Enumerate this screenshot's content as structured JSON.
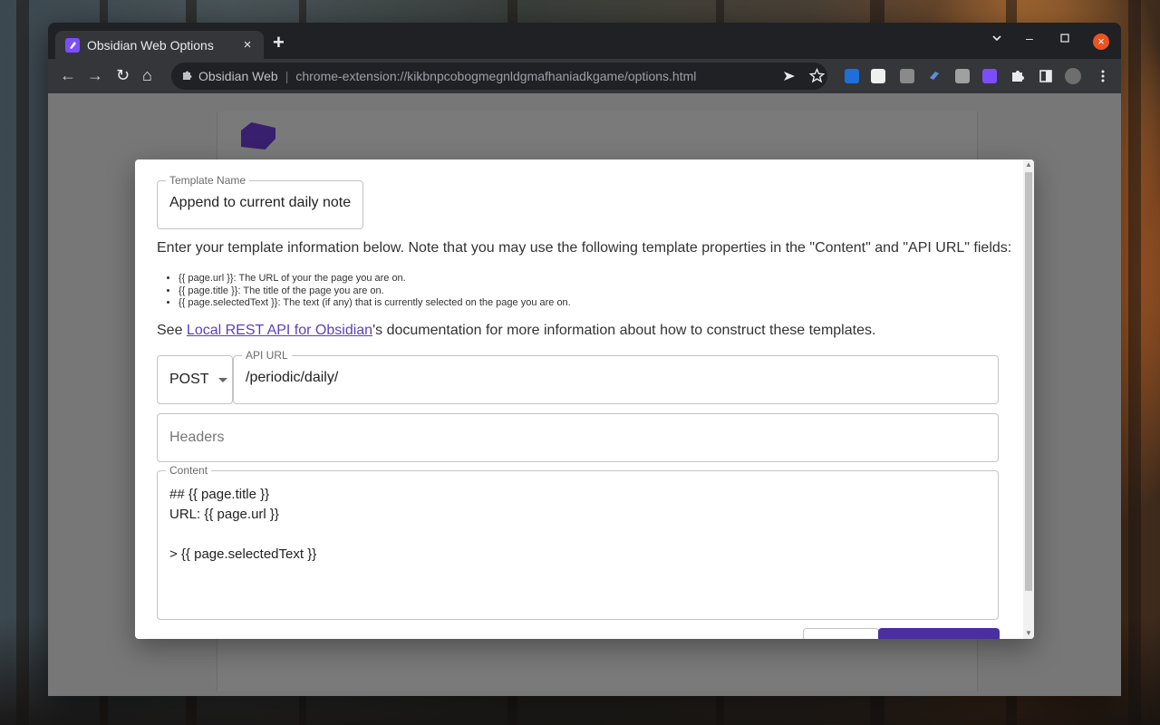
{
  "browser": {
    "tab_title": "Obsidian Web Options",
    "tab_close": "×",
    "new_tab": "+",
    "site_name": "Obsidian Web",
    "url": "chrome-extension://kikbnpcobogmegnldgmafhaniadkgame/options.html",
    "omni_separator": "|",
    "window_controls": {
      "dropdown": "⌄",
      "minimize": "–",
      "maximize": "□",
      "close": "×"
    },
    "nav": {
      "back": "←",
      "forward": "→",
      "reload": "↻",
      "home": "⌂"
    },
    "toolbar_icons": [
      "send-icon",
      "star-icon",
      "extension-1-icon",
      "extension-2-icon",
      "extension-3-icon",
      "extension-4-icon",
      "extension-5-icon",
      "obsidian-extension-icon",
      "puzzle-icon",
      "side-panel-icon",
      "profile-avatar",
      "more-menu-icon"
    ]
  },
  "dialog": {
    "template_name_label": "Template Name",
    "template_name_value": "Append to current daily note",
    "intro_text": "Enter your template information below. Note that you may use the following template properties in the \"Content\" and \"API URL\" fields:",
    "properties": [
      "{{ page.url }}: The URL of your the page you are on.",
      "{{ page.title }}: The title of the page you are on.",
      "{{ page.selectedText }}: The text (if any) that is currently selected on the page you are on."
    ],
    "see_prefix": "See ",
    "see_link": "Local REST API for Obsidian",
    "see_suffix": "'s documentation for more information about how to construct these templates.",
    "method_value": "POST",
    "api_url_label": "API URL",
    "api_url_value": "/periodic/daily/",
    "headers_placeholder": "Headers",
    "content_label": "Content",
    "content_lines": [
      "## {{ page.title }}",
      "URL: {{ page.url }}",
      "",
      "> {{ page.selectedText }}"
    ]
  },
  "colors": {
    "accent": "#4a2fa0",
    "link": "#5a3fc0",
    "ubuntu_close": "#e95420"
  }
}
